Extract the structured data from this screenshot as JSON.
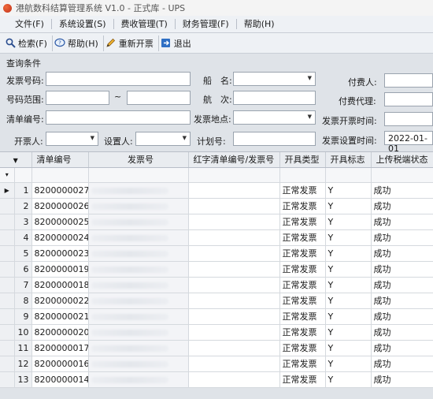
{
  "window": {
    "title": "港航数科结算管理系统 V1.0 - 正式库 - UPS"
  },
  "menu": [
    "文件(F)",
    "系统设置(S)",
    "费收管理(T)",
    "财务管理(F)",
    "帮助(H)"
  ],
  "toolbar": {
    "search": "检索(F)",
    "help": "帮助(H)",
    "reissue": "重新开票",
    "exit": "退出"
  },
  "query": {
    "section_title": "查询条件",
    "invoice_no_label": "发票号码:",
    "ship_name_label": "船　名:",
    "payer_label": "付费人:",
    "number_range_label": "号码范围:",
    "range_tilde": "~",
    "voyage_label": "航　次:",
    "pay_agent_label": "付费代理:",
    "list_no_label": "清单编号:",
    "invoice_place_label": "发票地点:",
    "invoice_time_label": "发票开票时间:",
    "issuer_label": "开票人:",
    "setter_label": "设置人:",
    "plan_no_label": "计划号:",
    "setting_time_label": "发票设置时间:",
    "setting_time_value": "2022-01-01"
  },
  "grid": {
    "columns": [
      "清单编号",
      "发票号",
      "红字清单编号/发票号",
      "开具类型",
      "开具标志",
      "上传税端状态"
    ],
    "rows": [
      {
        "no": "1",
        "list_no": "8200000027",
        "type": "正常发票",
        "flag": "Y",
        "status": "成功"
      },
      {
        "no": "2",
        "list_no": "8200000026",
        "type": "正常发票",
        "flag": "Y",
        "status": "成功"
      },
      {
        "no": "3",
        "list_no": "8200000025",
        "type": "正常发票",
        "flag": "Y",
        "status": "成功"
      },
      {
        "no": "4",
        "list_no": "8200000024",
        "type": "正常发票",
        "flag": "Y",
        "status": "成功"
      },
      {
        "no": "5",
        "list_no": "8200000023",
        "type": "正常发票",
        "flag": "Y",
        "status": "成功"
      },
      {
        "no": "6",
        "list_no": "8200000019",
        "type": "正常发票",
        "flag": "Y",
        "status": "成功"
      },
      {
        "no": "7",
        "list_no": "8200000018",
        "type": "正常发票",
        "flag": "Y",
        "status": "成功"
      },
      {
        "no": "8",
        "list_no": "8200000022",
        "type": "正常发票",
        "flag": "Y",
        "status": "成功"
      },
      {
        "no": "9",
        "list_no": "8200000021",
        "type": "正常发票",
        "flag": "Y",
        "status": "成功"
      },
      {
        "no": "10",
        "list_no": "8200000020",
        "type": "正常发票",
        "flag": "Y",
        "status": "成功"
      },
      {
        "no": "11",
        "list_no": "8200000017",
        "type": "正常发票",
        "flag": "Y",
        "status": "成功"
      },
      {
        "no": "12",
        "list_no": "8200000016",
        "type": "正常发票",
        "flag": "Y",
        "status": "成功"
      },
      {
        "no": "13",
        "list_no": "8200000014",
        "type": "正常发票",
        "flag": "Y",
        "status": "成功"
      },
      {
        "no": "14",
        "list_no": "8200000013",
        "type": "正常发票",
        "flag": "Y",
        "status": "成功"
      }
    ]
  }
}
